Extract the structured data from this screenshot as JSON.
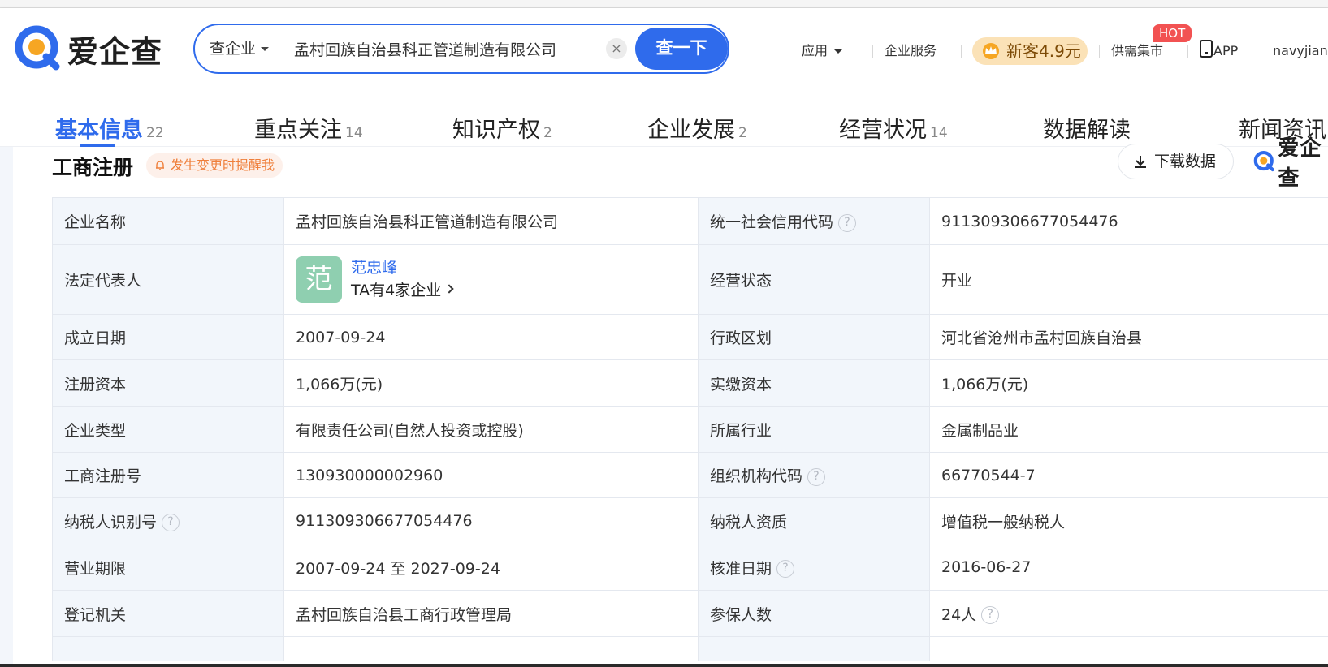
{
  "brand": {
    "name": "爱企查",
    "color": "#2f6bec",
    "accent": "#f6a623"
  },
  "search": {
    "type_label": "查企业",
    "value": "孟村回族自治县科正管道制造有限公司",
    "clear_icon": "×",
    "button_label": "查一下"
  },
  "nav": {
    "apps": "应用",
    "enterprise_service": "企业服务",
    "promo": "新客4.9元",
    "supply_market": "供需集市",
    "hot_badge": "HOT",
    "app": "APP",
    "user": "navyjian"
  },
  "tabs": [
    {
      "label": "基本信息",
      "count": "22"
    },
    {
      "label": "重点关注",
      "count": "14"
    },
    {
      "label": "知识产权",
      "count": "2"
    },
    {
      "label": "企业发展",
      "count": "2"
    },
    {
      "label": "经营状况",
      "count": "14"
    },
    {
      "label": "数据解读",
      "count": ""
    },
    {
      "label": "新闻资讯",
      "count": ""
    }
  ],
  "section": {
    "title": "工商注册",
    "remind": "发生变更时提醒我",
    "download": "下载数据",
    "help_icon": "?"
  },
  "info": {
    "company_name_label": "企业名称",
    "company_name": "孟村回族自治县科正管道制造有限公司",
    "credit_code_label": "统一社会信用代码",
    "credit_code": "911309306677054476",
    "legal_rep_label": "法定代表人",
    "legal_rep_avatar": "范",
    "legal_rep_name": "范忠峰",
    "legal_rep_companies": "TA有4家企业",
    "status_label": "经营状态",
    "status": "开业",
    "founded_label": "成立日期",
    "founded": "2007-09-24",
    "region_label": "行政区划",
    "region": "河北省沧州市孟村回族自治县",
    "reg_capital_label": "注册资本",
    "reg_capital": "1,066万(元)",
    "paid_capital_label": "实缴资本",
    "paid_capital": "1,066万(元)",
    "type_label": "企业类型",
    "type": "有限责任公司(自然人投资或控股)",
    "industry_label": "所属行业",
    "industry": "金属制品业",
    "reg_no_label": "工商注册号",
    "reg_no": "130930000002960",
    "org_code_label": "组织机构代码",
    "org_code": "66770544-7",
    "taxpayer_id_label": "纳税人识别号",
    "taxpayer_id": "911309306677054476",
    "taxpayer_qual_label": "纳税人资质",
    "taxpayer_qual": "增值税一般纳税人",
    "term_label": "营业期限",
    "term": "2007-09-24 至 2027-09-24",
    "approval_label": "核准日期",
    "approval": "2016-06-27",
    "authority_label": "登记机关",
    "authority": "孟村回族自治县工商行政管理局",
    "insured_label": "参保人数",
    "insured": "24人"
  }
}
